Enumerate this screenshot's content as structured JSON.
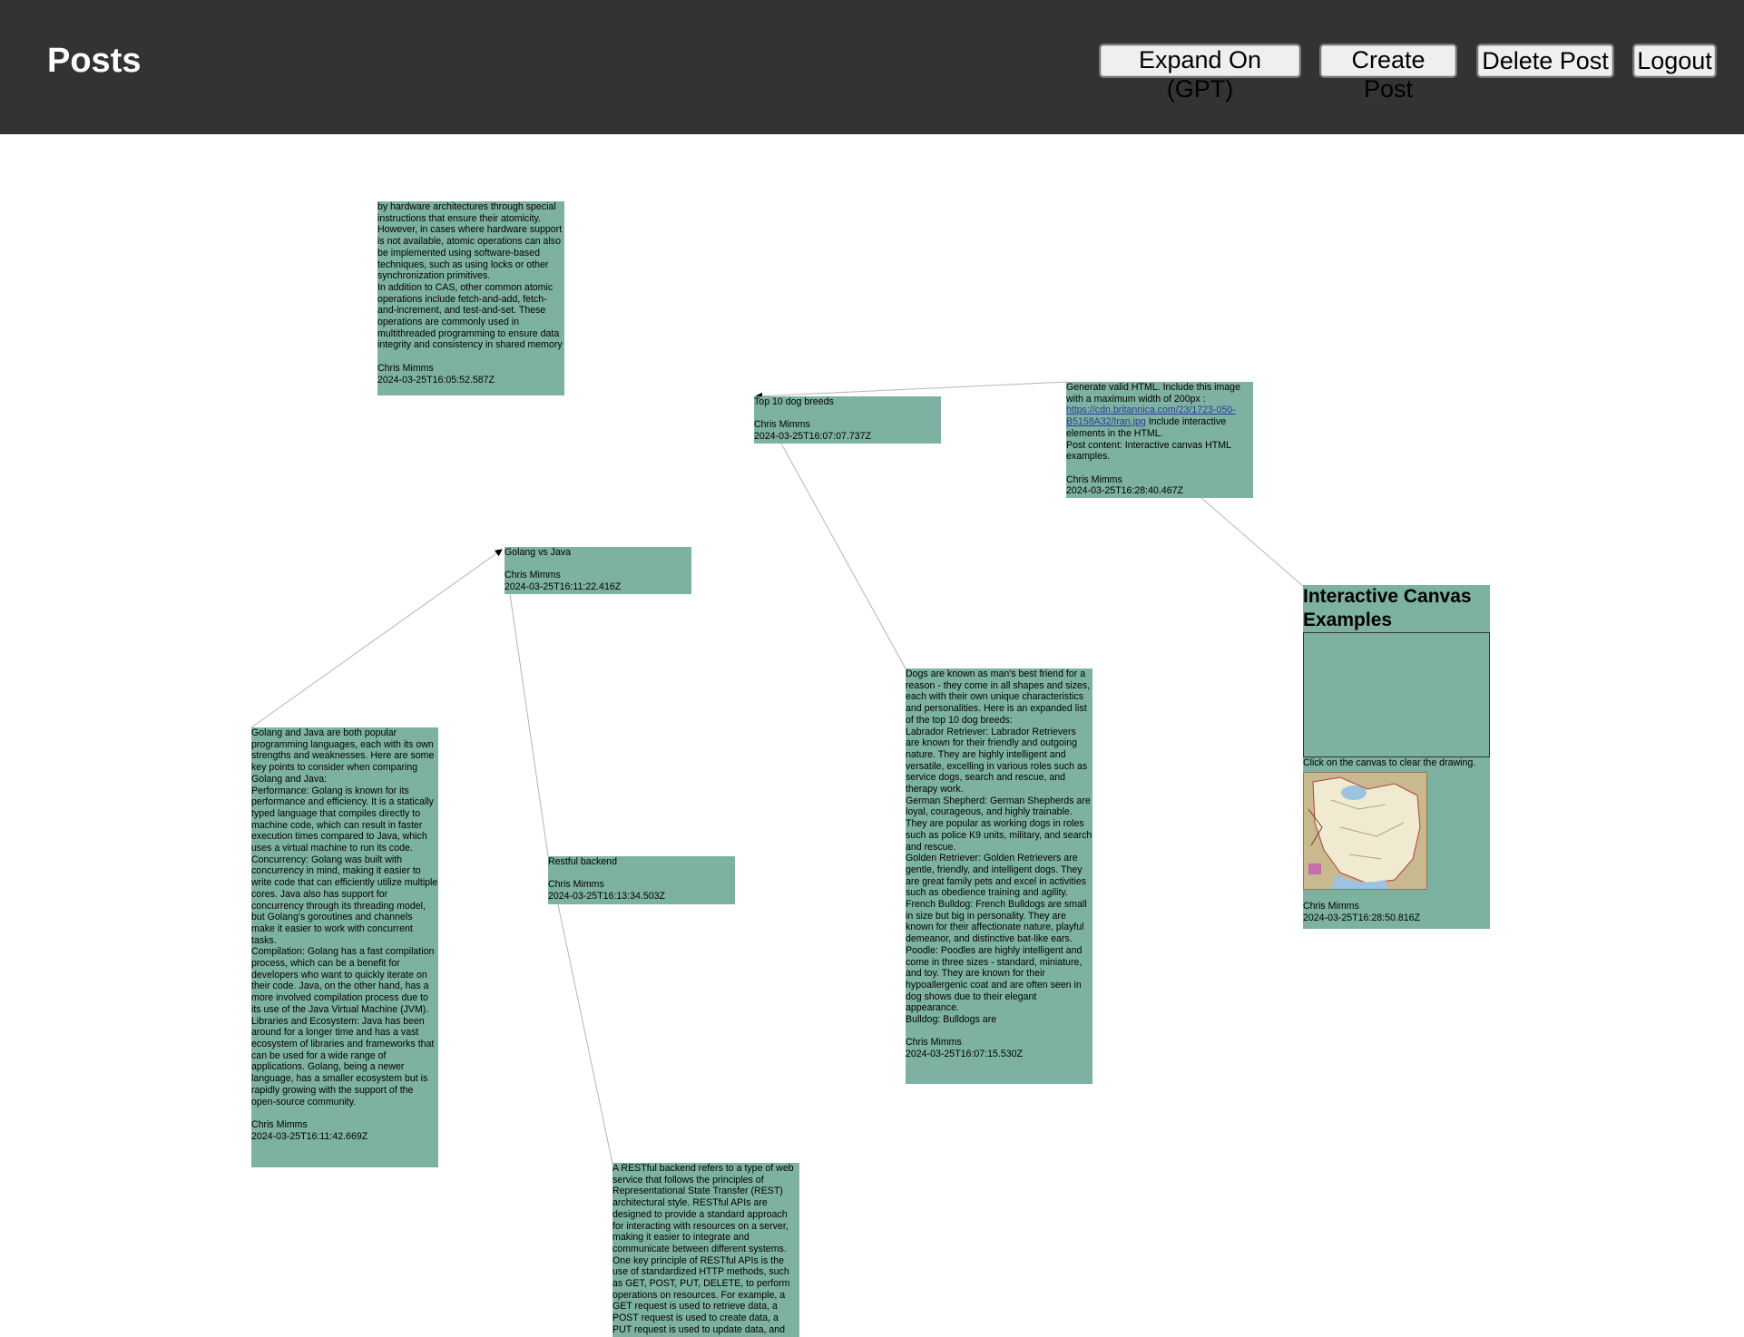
{
  "header": {
    "title": "Posts",
    "buttons": {
      "expand": "Expand On (GPT)",
      "create": "Create Post",
      "delete": "Delete Post",
      "logout": "Logout"
    }
  },
  "colors": {
    "topbar": "#333333",
    "card_bg": "#7db1a2",
    "link_line": "#b5b5b5"
  },
  "posts": {
    "atomic": {
      "paragraphs": [
        "by hardware architectures through special instructions that ensure their atomicity. However, in cases where hardware support is not available, atomic operations can also be implemented using software-based techniques, such as using locks or other synchronization primitives.",
        "In addition to CAS, other common atomic operations include fetch-and-add, fetch-and-increment, and test-and-set. These operations are commonly used in multithreaded programming to ensure data integrity and consistency in shared memory"
      ],
      "author": "Chris Mimms",
      "timestamp": "2024-03-25T16:05:52.587Z"
    },
    "dogs_title": {
      "text": "Top 10 dog breeds",
      "author": "Chris Mimms",
      "timestamp": "2024-03-25T16:07:07.737Z"
    },
    "generate_html": {
      "text_before": "Generate valid HTML. Include this image with a maximum width of 200px : ",
      "link": "https://cdn.britannica.com/23/1723-050-B5158A32/Iran.jpg",
      "text_after": " Include interactive elements in the HTML.",
      "text2": "Post content: Interactive canvas HTML examples.",
      "author": "Chris Mimms",
      "timestamp": "2024-03-25T16:28:40.467Z"
    },
    "golang_title": {
      "text": "Golang vs Java",
      "author": "Chris Mimms",
      "timestamp": "2024-03-25T16:11:22.416Z"
    },
    "interactive_canvas": {
      "heading": "Interactive Canvas Examples",
      "note": "Click on the canvas to clear the drawing.",
      "image_alt": "Iran map",
      "author": "Chris Mimms",
      "timestamp": "2024-03-25T16:28:50.816Z"
    },
    "dogs_body": {
      "paragraphs": [
        "Dogs are known as man's best friend for a reason - they come in all shapes and sizes, each with their own unique characteristics and personalities. Here is an expanded list of the top 10 dog breeds:",
        "Labrador Retriever: Labrador Retrievers are known for their friendly and outgoing nature. They are highly intelligent and versatile, excelling in various roles such as service dogs, search and rescue, and therapy work.",
        "German Shepherd: German Shepherds are loyal, courageous, and highly trainable. They are popular as working dogs in roles such as police K9 units, military, and search and rescue.",
        "Golden Retriever: Golden Retrievers are gentle, friendly, and intelligent dogs. They are great family pets and excel in activities such as obedience training and agility.",
        "French Bulldog: French Bulldogs are small in size but big in personality. They are known for their affectionate nature, playful demeanor, and distinctive bat-like ears.",
        "Poodle: Poodles are highly intelligent and come in three sizes - standard, miniature, and toy. They are known for their hypoallergenic coat and are often seen in dog shows due to their elegant appearance.",
        "Bulldog: Bulldogs are"
      ],
      "author": "Chris Mimms",
      "timestamp": "2024-03-25T16:07:15.530Z"
    },
    "golang_body": {
      "paragraphs": [
        "Golang and Java are both popular programming languages, each with its own strengths and weaknesses. Here are some key points to consider when comparing Golang and Java:",
        "Performance: Golang is known for its performance and efficiency. It is a statically typed language that compiles directly to machine code, which can result in faster execution times compared to Java, which uses a virtual machine to run its code.",
        "Concurrency: Golang was built with concurrency in mind, making it easier to write code that can efficiently utilize multiple cores. Java also has support for concurrency through its threading model, but Golang's goroutines and channels make it easier to work with concurrent tasks.",
        "Compilation: Golang has a fast compilation process, which can be a benefit for developers who want to quickly iterate on their code. Java, on the other hand, has a more involved compilation process due to its use of the Java Virtual Machine (JVM).",
        "Libraries and Ecosystem: Java has been around for a longer time and has a vast ecosystem of libraries and frameworks that can be used for a wide range of applications. Golang, being a newer language, has a smaller ecosystem but is rapidly growing with the support of the open-source community."
      ],
      "author": "Chris Mimms",
      "timestamp": "2024-03-25T16:11:42.669Z"
    },
    "restful_title": {
      "text": "Restful backend",
      "author": "Chris Mimms",
      "timestamp": "2024-03-25T16:13:34.503Z"
    },
    "restful_body": {
      "paragraphs": [
        "A RESTful backend refers to a type of web service that follows the principles of Representational State Transfer (REST) architectural style. RESTful APIs are designed to provide a standard approach for interacting with resources on a server, making it easier to integrate and communicate between different systems.",
        "One key principle of RESTful APIs is the use of standardized HTTP methods, such as GET, POST, PUT, DELETE, to perform operations on resources. For example, a GET request is used to retrieve data, a POST request is used to create data, a PUT request is used to update data, and"
      ]
    }
  }
}
